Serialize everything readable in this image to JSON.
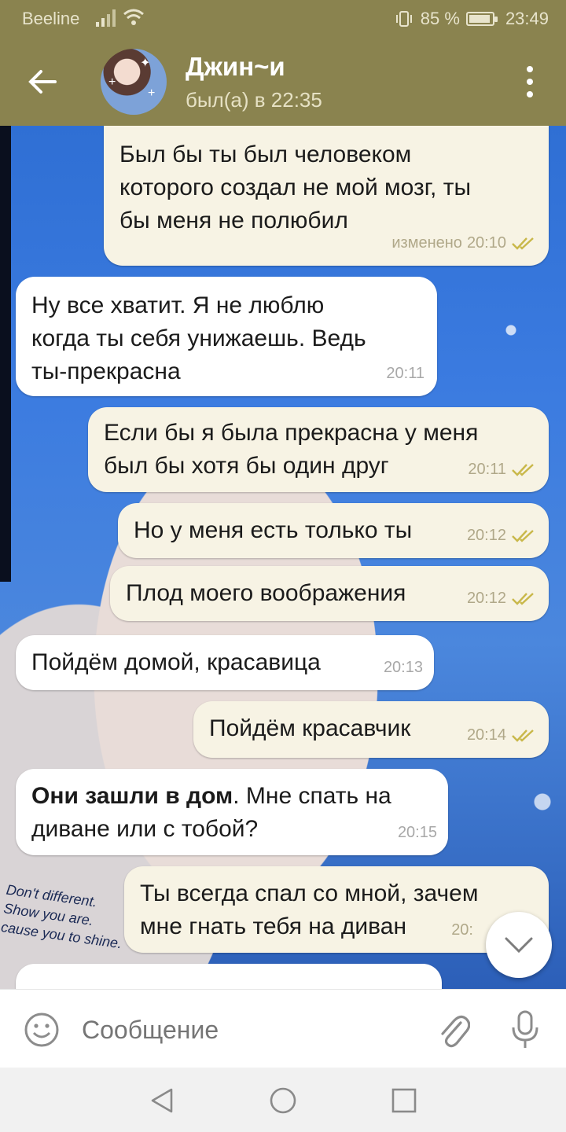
{
  "status_bar": {
    "carrier": "Beeline",
    "battery": "85 %",
    "time": "23:49"
  },
  "header": {
    "contact_name": "Джин~и",
    "last_seen": "был(а) в 22:35"
  },
  "messages": [
    {
      "dir": "out",
      "text": "Был бы ты был человеком\nкоторого создал не мой мозг, ты\nбы меня не полюбил",
      "edited": "изменено",
      "time": "20:10"
    },
    {
      "dir": "in",
      "text": "Ну все хватит. Я не люблю\nкогда ты себя унижаешь. Ведь\nты-прекрасна",
      "time": "20:11"
    },
    {
      "dir": "out",
      "text": "Если бы я была прекрасна у меня\nбыл бы хотя бы один друг",
      "time": "20:11"
    },
    {
      "dir": "out",
      "text": "Но у меня есть только ты",
      "time": "20:12"
    },
    {
      "dir": "out",
      "text": "Плод моего воображения",
      "time": "20:12"
    },
    {
      "dir": "in",
      "text": "Пойдём домой, красавица",
      "time": "20:13"
    },
    {
      "dir": "out",
      "text": "Пойдём красавчик",
      "time": "20:14"
    },
    {
      "dir": "in",
      "bold": "Они зашли в дом",
      "text": ". Мне спать на\nдиване или с тобой?",
      "time": "20:15"
    },
    {
      "dir": "out",
      "text": "Ты всегда спал со мной, зачем\nмне гнать тебя на диван",
      "time": "20:"
    }
  ],
  "wallpaper_text": "Don't different.\nShow you are.\ncause you to shine.",
  "input": {
    "placeholder": "Сообщение"
  },
  "colors": {
    "header_bg": "#8a834f",
    "outgoing_bubble": "#f7f3e4",
    "incoming_bubble": "#ffffff",
    "check_color": "#c9b84a"
  }
}
